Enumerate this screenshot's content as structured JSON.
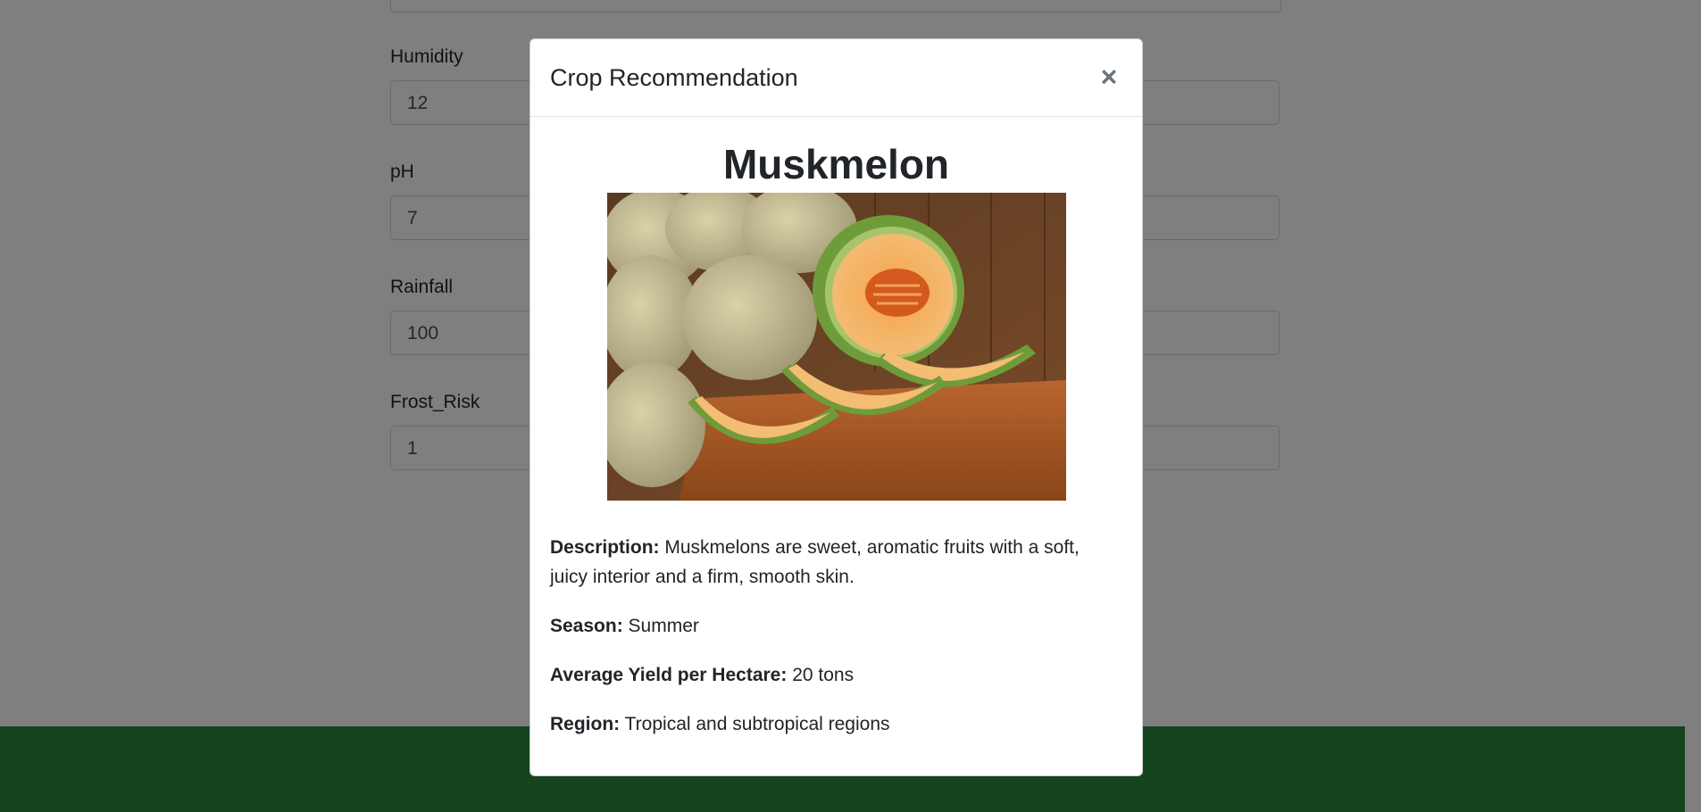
{
  "form": {
    "fields": [
      {
        "label": "Humidity",
        "value": "12"
      },
      {
        "label": "pH",
        "value": "7"
      },
      {
        "label": "Rainfall",
        "value": "100"
      },
      {
        "label": "Frost_Risk",
        "value": "1"
      }
    ]
  },
  "modal": {
    "title": "Crop Recommendation",
    "close_symbol": "×",
    "crop_name": "Muskmelon",
    "description_label": "Description:",
    "description_text": "Muskmelons are sweet, aromatic fruits with a soft, juicy interior and a firm, smooth skin.",
    "season_label": "Season:",
    "season_value": "Summer",
    "yield_label": "Average Yield per Hectare:",
    "yield_value": "20 tons",
    "region_label": "Region:",
    "region_value": "Tropical and subtropical regions"
  },
  "colors": {
    "footer": "#2b8a3e",
    "backdrop": "rgba(0,0,0,0.5)"
  }
}
